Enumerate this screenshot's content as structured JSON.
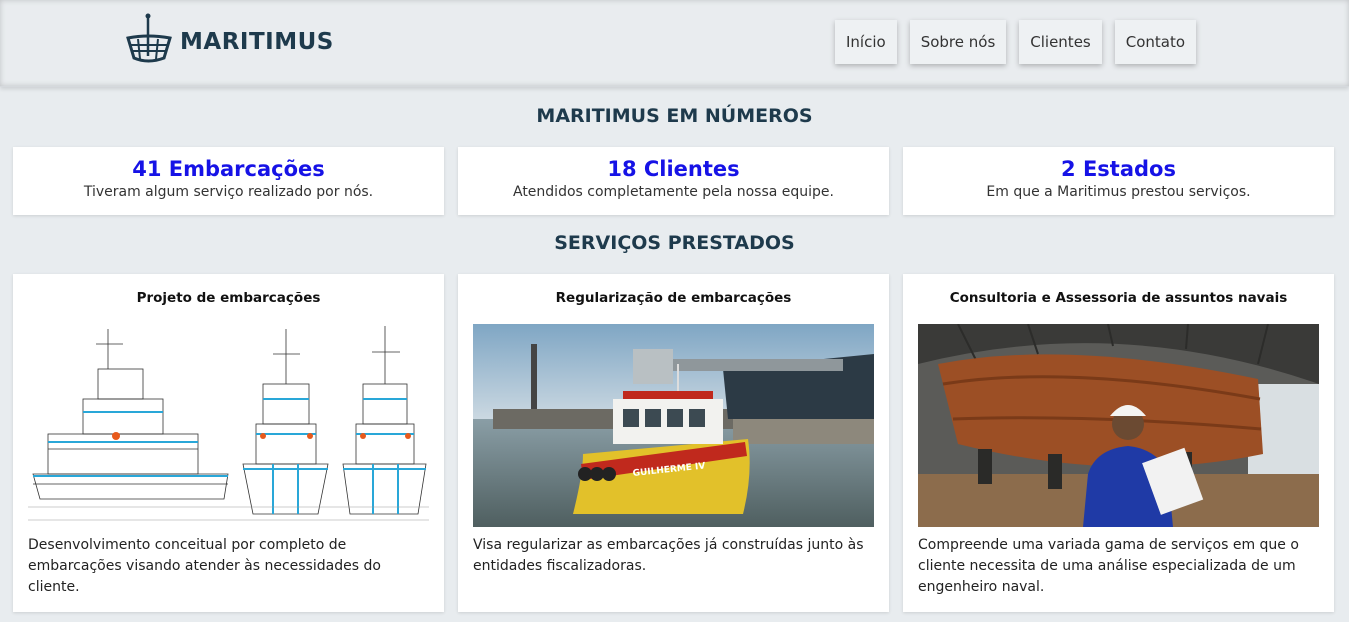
{
  "header": {
    "brand": "MARITIMUS",
    "logo_icon": "ship-logo-icon",
    "nav": [
      "Início",
      "Sobre nós",
      "Clientes",
      "Contato"
    ]
  },
  "numbers": {
    "title": "MARITIMUS EM NÚMEROS",
    "items": [
      {
        "value": "41 Embarcações",
        "desc": "Tiveram algum serviço realizado por nós."
      },
      {
        "value": "18 Clientes",
        "desc": "Atendidos completamente pela nossa equipe."
      },
      {
        "value": "2 Estados",
        "desc": "Em que a Maritimus prestou serviços."
      }
    ]
  },
  "services": {
    "title": "SERVIÇOS PRESTADOS",
    "items": [
      {
        "title": "Projeto de embarcações",
        "desc": "Desenvolvimento conceitual por completo de embarcações visando atender às necessidades do cliente.",
        "image": "vessel-blueprint-image"
      },
      {
        "title": "Regularização de embarcações",
        "desc": "Visa regularizar as embarcações já construídas junto às entidades fiscalizadoras.",
        "image": "boat-in-harbor-photo",
        "boat_name": "GUILHERME IV"
      },
      {
        "title": "Consultoria e Assessoria de assuntos navais",
        "desc": "Compreende uma variada gama de serviços em que o cliente necessita de uma análise especializada de um engenheiro naval.",
        "image": "engineer-shipyard-photo"
      }
    ]
  },
  "colors": {
    "accent_blue": "#1612e6",
    "brand_navy": "#1e3a4c",
    "background": "#e8ecef"
  }
}
